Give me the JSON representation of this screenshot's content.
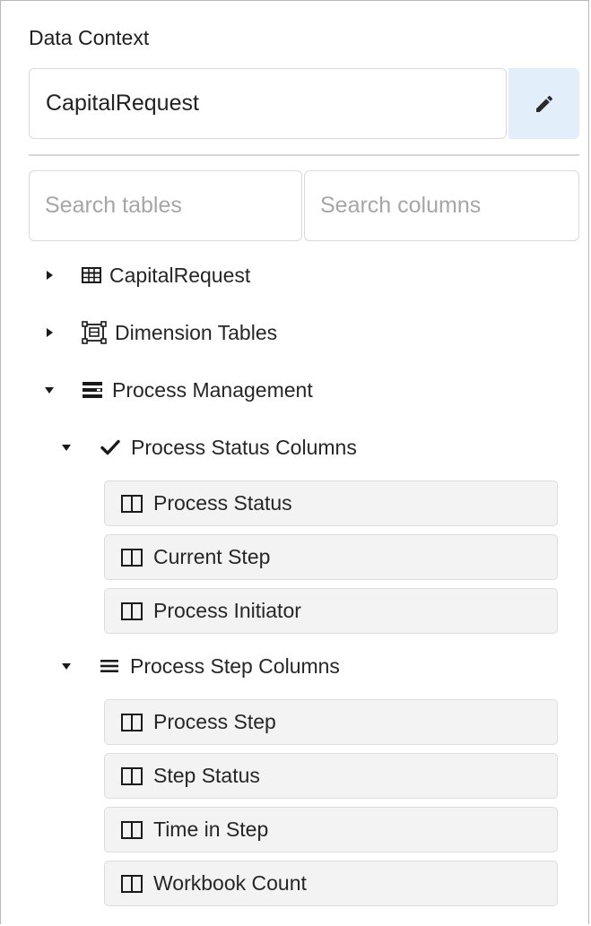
{
  "data_context": {
    "label": "Data Context",
    "value": "CapitalRequest",
    "edit_icon": "pencil-icon"
  },
  "search": {
    "tables_placeholder": "Search tables",
    "columns_placeholder": "Search columns"
  },
  "tree": {
    "capital_request": {
      "label": "CapitalRequest",
      "icon": "table-grid-icon",
      "expanded": false
    },
    "dimension_tables": {
      "label": "Dimension Tables",
      "icon": "dimension-tables-icon",
      "expanded": false
    },
    "process_management": {
      "label": "Process Management",
      "icon": "list-stack-icon",
      "expanded": true
    },
    "process_status_columns": {
      "label": "Process Status Columns",
      "icon": "checkmark-icon",
      "expanded": true,
      "items": [
        "Process Status",
        "Current Step",
        "Process Initiator"
      ]
    },
    "process_step_columns": {
      "label": "Process Step Columns",
      "icon": "hamburger-icon",
      "expanded": true,
      "items": [
        "Process Step",
        "Step Status",
        "Time in Step",
        "Workbook Count"
      ]
    }
  },
  "colors": {
    "edit_button_bg": "#e3eefb",
    "column_item_bg": "#f3f3f3",
    "placeholder": "#a6a6a6"
  }
}
